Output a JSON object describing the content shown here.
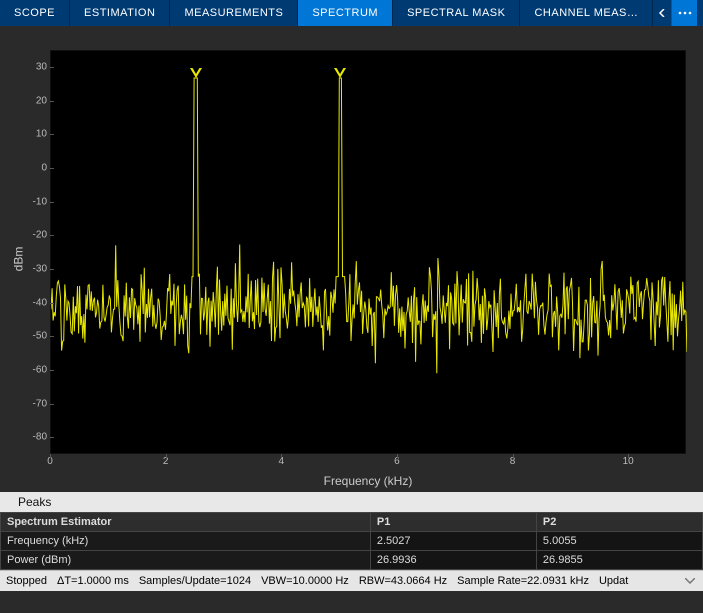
{
  "toolbar": {
    "tabs": [
      "SCOPE",
      "ESTIMATION",
      "MEASUREMENTS",
      "SPECTRUM",
      "SPECTRAL MASK",
      "CHANNEL MEAS…"
    ],
    "active_index": 3
  },
  "chart_data": {
    "type": "line",
    "title": "",
    "xlabel": "Frequency (kHz)",
    "ylabel": "dBm",
    "xlim": [
      0,
      11
    ],
    "ylim": [
      -85,
      35
    ],
    "xticks": [
      0,
      2,
      4,
      6,
      8,
      10
    ],
    "yticks": [
      -80,
      -70,
      -60,
      -50,
      -40,
      -30,
      -20,
      -10,
      0,
      10,
      20,
      30
    ],
    "series": [
      {
        "name": "Spectrum Estimator",
        "color": "#e9e900",
        "noise_floor_mean_dBm": -42,
        "noise_floor_std_dBm": 6,
        "peaks": [
          {
            "label": "P1",
            "freq_kHz": 2.5027,
            "power_dBm": 26.9936
          },
          {
            "label": "P2",
            "freq_kHz": 5.0055,
            "power_dBm": 26.9855
          }
        ]
      }
    ]
  },
  "peaks_panel": {
    "title": "Peaks",
    "columns": [
      "Spectrum Estimator",
      "P1",
      "P2"
    ],
    "rows": [
      {
        "label": "Frequency (kHz)",
        "values": [
          "2.5027",
          "5.0055"
        ]
      },
      {
        "label": "Power (dBm)",
        "values": [
          "26.9936",
          "26.9855"
        ]
      }
    ]
  },
  "status": {
    "state": "Stopped",
    "items": [
      "ΔT=1.0000 ms",
      "Samples/Update=1024",
      "VBW=10.0000 Hz",
      "RBW=43.0664 Hz",
      "Sample Rate=22.0931 kHz",
      "Updat"
    ]
  }
}
